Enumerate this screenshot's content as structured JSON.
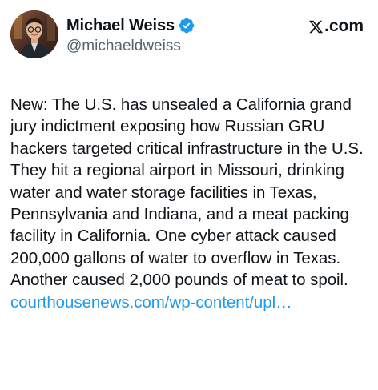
{
  "author": {
    "display_name": "Michael Weiss",
    "handle": "@michaeldweiss",
    "verified": true
  },
  "source_label": ".com",
  "icons": {
    "verified": "verified-badge-icon",
    "source_logo": "x-logo-icon"
  },
  "tweet": {
    "text": "New: The U.S. has unsealed a California grand jury indictment exposing how Russian GRU hackers targeted critical infrastructure in the U.S. They hit a regional airport in Missouri, drinking water and water storage facilities in Texas, Pennsylvania and Indiana, and a meat packing facility in California. One cyber attack caused 200,000 gallons of water to overflow in Texas. Another caused 2,000 pounds of meat to spoil.",
    "link": "courthousenews.com/wp-content/upl…"
  },
  "colors": {
    "link": "#1d9bf0",
    "verified": "#1d9bf0",
    "text": "#0f1419",
    "handle": "#536471"
  }
}
